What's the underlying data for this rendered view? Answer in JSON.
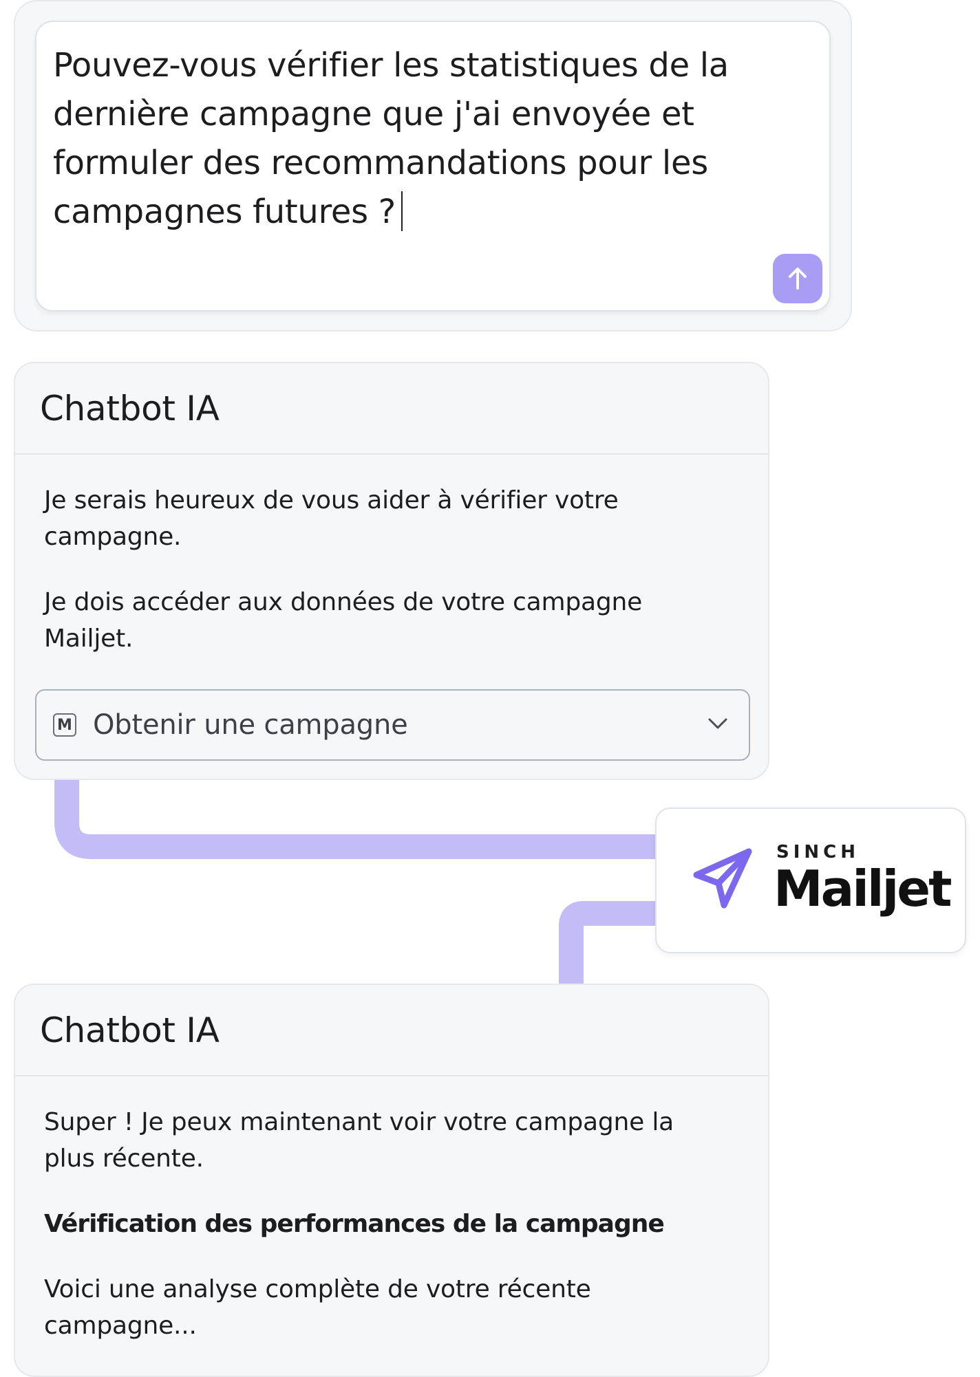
{
  "composer": {
    "text": "Pouvez-vous vérifier les statistiques de la dernière campagne que j'ai envoyée et formuler des recommandations pour les campagnes futures ?",
    "send_icon": "arrow-up-icon"
  },
  "chat": [
    {
      "title": "Chatbot IA",
      "paragraphs": [
        "Je serais heureux de vous aider à vérifier votre campagne.",
        "Je dois accéder aux données de votre campagne Mailjet."
      ],
      "tool": {
        "badge": "M",
        "label": "Obtenir une campagne",
        "icon": "chevron-down-icon"
      }
    },
    {
      "title": "Chatbot IA",
      "paragraphs": [
        "Super ! Je peux maintenant voir votre campagne la plus récente.",
        "Vérification des performances de la campagne",
        "Voici une analyse complète de votre récente campagne..."
      ]
    }
  ],
  "integration": {
    "brand_top": "SINCH",
    "brand_name": "Mailjet",
    "icon": "paper-plane-icon"
  },
  "colors": {
    "accent": "#a89cf4",
    "connector": "#c4bcf7",
    "logo_mark": "#7b68ee"
  }
}
